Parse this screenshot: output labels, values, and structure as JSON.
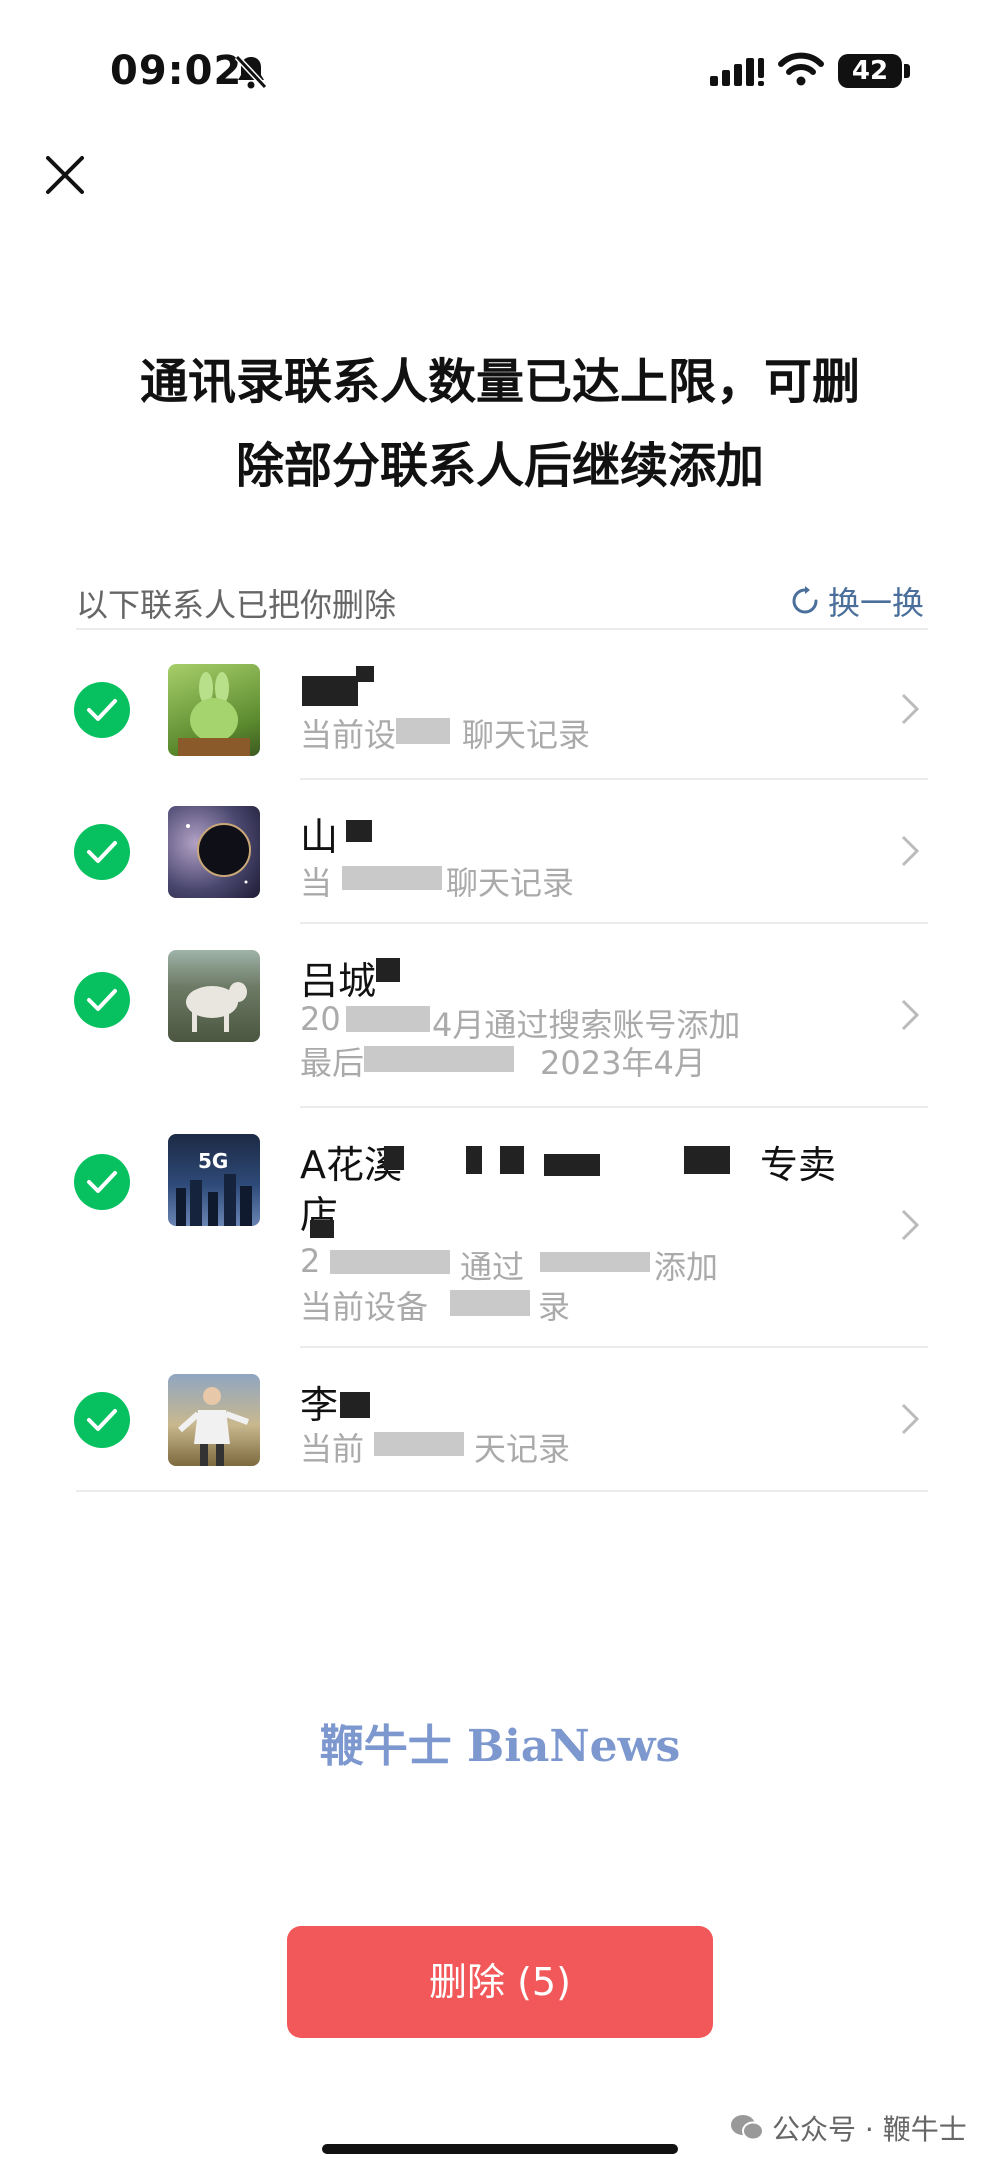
{
  "status_bar": {
    "time": "09:02",
    "battery": "42"
  },
  "header": {
    "title_line1": "通讯录联系人数量已达上限，可删",
    "title_line2": "除部分联系人后继续添加"
  },
  "section": {
    "label": "以下联系人已把你删除",
    "refresh_label": "换一换"
  },
  "contacts": [
    {
      "name": "",
      "sub1": "当前设",
      "sub1b": "聊天记录",
      "sub2": ""
    },
    {
      "name": "山",
      "sub1": "当",
      "sub1b": "聊天记录",
      "sub2": ""
    },
    {
      "name": "吕城",
      "sub1": "20",
      "sub1b": "4月通过搜索账号添加",
      "sub2": "最后",
      "sub2b": "2023年4月"
    },
    {
      "name": "A花溪",
      "name_tail": "专卖",
      "name_line2": "店",
      "sub1": "2",
      "sub1b": "通过",
      "sub1c": "添加",
      "sub2": "当前设备",
      "sub2b": "录"
    },
    {
      "name": "李",
      "sub1": "当前",
      "sub1b": "天记录",
      "sub2": ""
    }
  ],
  "watermark": "鞭牛士 BiaNews",
  "delete_button": "删除 (5)",
  "footer": {
    "credit": "公众号 · 鞭牛士"
  },
  "colors": {
    "check_green": "#07c160",
    "delete_red": "#f2585a",
    "link_blue": "#4a6f9a",
    "watermark_blue": "#7d97cf"
  }
}
